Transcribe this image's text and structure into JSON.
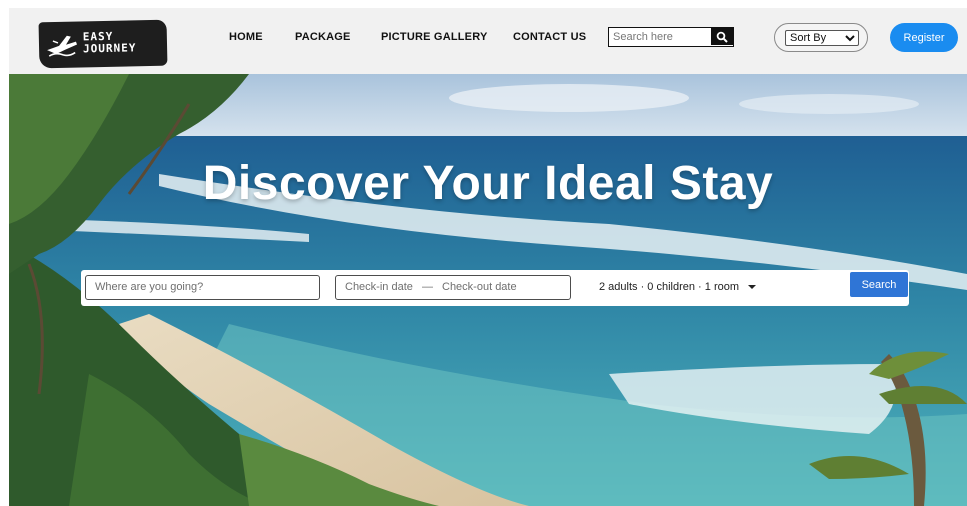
{
  "logo": {
    "line1": "EASY",
    "line2": "JOURNEY"
  },
  "nav": [
    {
      "label": "HOME"
    },
    {
      "label": "PACKAGE"
    },
    {
      "label": "PICTURE GALLERY"
    },
    {
      "label": "CONTACT US"
    }
  ],
  "search": {
    "placeholder": "Search here",
    "icon": "search-icon"
  },
  "sort": {
    "selected": "Sort By"
  },
  "register": {
    "label": "Register"
  },
  "hero": {
    "title": "Discover Your Ideal Stay"
  },
  "booking": {
    "destination_placeholder": "Where are you going?",
    "checkin": "Check-in date",
    "dash": "—",
    "checkout": "Check-out date",
    "guests": "2 adults · 0 children · 1 room",
    "search_label": "Search"
  },
  "colors": {
    "header_bg": "#f1f1f1",
    "register": "#1a8cf0",
    "search_button": "#2f75d6"
  }
}
